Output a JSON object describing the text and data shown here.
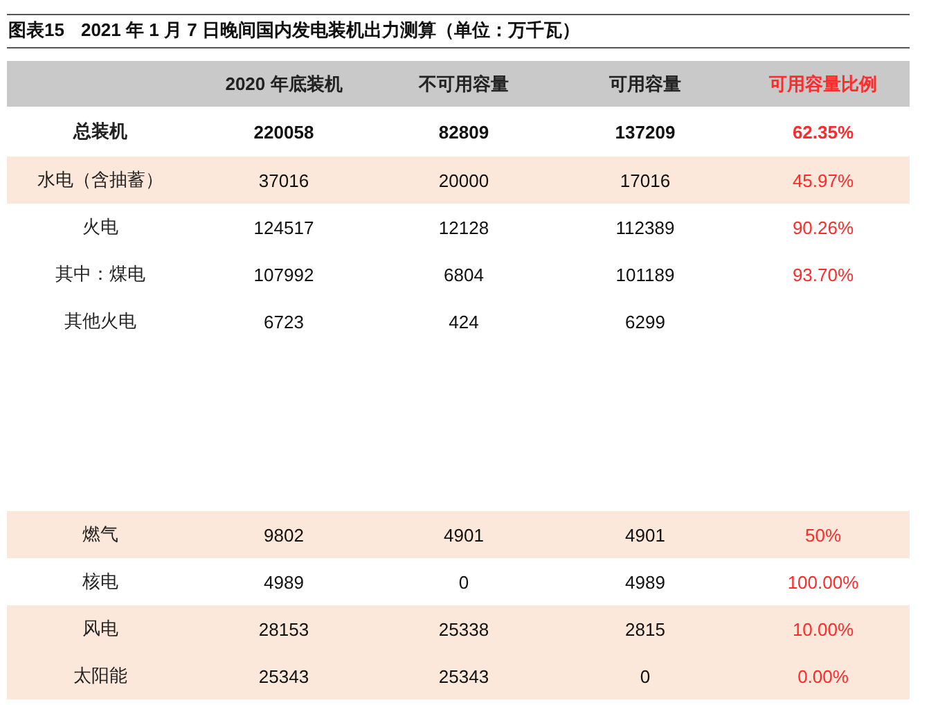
{
  "caption": {
    "label": "图表15",
    "title": "2021 年 1 月 7 日晚间国内发电装机出力测算（单位：万千瓦）"
  },
  "table": {
    "columns": [
      "2020 年底装机",
      "不可用容量",
      "可用容量",
      "可用容量比例"
    ],
    "rows": [
      {
        "name": "总装机",
        "values": [
          "220058",
          "82809",
          "137209"
        ],
        "ratio": "62.35%",
        "bold": true,
        "shaded": false
      },
      {
        "name": "水电（含抽蓄）",
        "values": [
          "37016",
          "20000",
          "17016"
        ],
        "ratio": "45.97%",
        "bold": false,
        "shaded": true
      },
      {
        "name": "火电",
        "values": [
          "124517",
          "12128",
          "112389"
        ],
        "ratio": "90.26%",
        "bold": false,
        "shaded": false
      },
      {
        "name": "其中：煤电",
        "values": [
          "107992",
          "6804",
          "101189"
        ],
        "ratio": "93.70%",
        "bold": false,
        "shaded": false
      },
      {
        "name": "其他火电",
        "values": [
          "6723",
          "424",
          "6299"
        ],
        "bold": false,
        "shaded": false,
        "gap_after": true
      },
      {
        "name": "燃气",
        "values": [
          "9802",
          "4901",
          "4901"
        ],
        "ratio": "50%",
        "bold": false,
        "shaded": true
      },
      {
        "name": "核电",
        "values": [
          "4989",
          "0",
          "4989"
        ],
        "ratio": "100.00%",
        "bold": false,
        "shaded": false
      },
      {
        "name": "风电",
        "values": [
          "28153",
          "25338",
          "2815"
        ],
        "ratio": "10.00%",
        "bold": false,
        "shaded": true
      },
      {
        "name": "太阳能",
        "values": [
          "25343",
          "25343",
          "0"
        ],
        "ratio": "0.00%",
        "bold": false,
        "shaded": true
      }
    ]
  }
}
